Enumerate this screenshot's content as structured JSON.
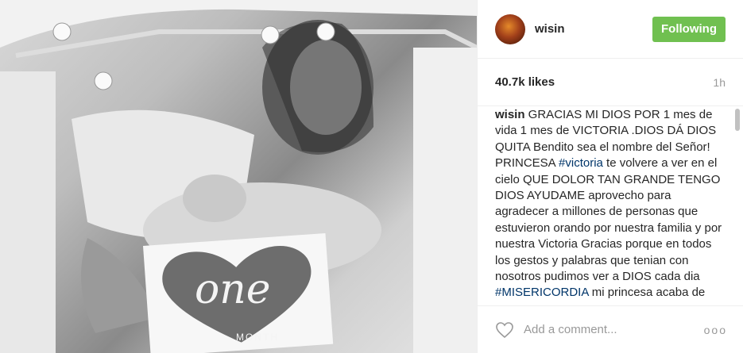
{
  "header": {
    "username": "wisin",
    "follow_label": "Following"
  },
  "stats": {
    "likes": "40.7k likes",
    "time": "1h"
  },
  "caption": {
    "username": "wisin",
    "part1": " GRACIAS MI DIOS POR 1 mes de vida 1 mes de VICTORIA .DIOS DÁ DIOS QUITA Bendito sea el nombre del Señor! PRINCESA ",
    "tag1": "#victoria",
    "part2": " te volvere a ver en el cielo QUE DOLOR TAN GRANDE TENGO DIOS AYUDAME aprovecho para agradecer a millones de personas que estuvieron orando por nuestra familia y por nuestra Victoria Gracias porque en todos los gestos y palabras que tenian con nosotros pudimos ver a DIOS cada dia ",
    "tag2": "#MISERICORDIA",
    "part3": " mi princesa acaba de fallecer"
  },
  "photo": {
    "card_word": "one",
    "card_sub": "MONTH"
  },
  "comment": {
    "placeholder": "Add a comment...",
    "more": "ooo"
  },
  "icons": {
    "heart": "heart-icon",
    "more": "more-options-icon"
  },
  "colors": {
    "follow": "#70c050",
    "hashtag": "#003569"
  }
}
